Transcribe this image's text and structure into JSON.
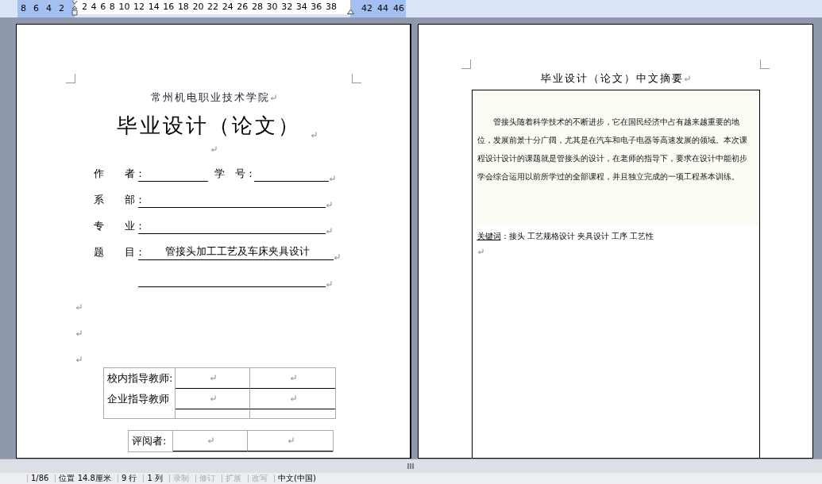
{
  "ruler": {
    "left_numbers": [
      "8",
      "6",
      "4",
      "2"
    ],
    "numbers": [
      "2",
      "4",
      "6",
      "8",
      "10",
      "12",
      "14",
      "16",
      "18",
      "20",
      "22",
      "24",
      "26",
      "28",
      "30",
      "32",
      "34",
      "36",
      "38"
    ],
    "right_numbers": [
      "42",
      "44",
      "46"
    ]
  },
  "cover_page": {
    "school": "常州机电职业技术学院",
    "title": "毕业设计（论文）",
    "fields": [
      {
        "kind": "pair",
        "label": "作　　者：",
        "label_2": "学　号："
      },
      {
        "kind": "line",
        "label": "系　　部："
      },
      {
        "kind": "line",
        "label": "专　　业："
      },
      {
        "kind": "value",
        "label": "题　　目：",
        "value": "管接头加工工艺及车床夹具设计"
      },
      {
        "kind": "blank"
      }
    ],
    "advisor_table": {
      "rows": [
        {
          "kind": "label",
          "label": "校内指导教师:"
        },
        {
          "kind": "label",
          "label": "企业指导教师"
        },
        {
          "kind": "empty"
        }
      ]
    },
    "reviewer_table": {
      "rows": [
        {
          "kind": "label",
          "label": "评阅者:"
        }
      ]
    }
  },
  "abstract_page": {
    "heading": "毕业设计（论文）中文摘要",
    "paragraph": "管接头随着科学技术的不断进步，它在国民经济中占有越来越重要的地位，发展前景十分广阔，尤其是在汽车和电子电器等高速发展的领域。本次课程设计设计的课题就是管接头的设计，在老师的指导下，要求在设计中能初步学会综合运用以前所学过的全部课程，并且独立完成的一项工程基本训练。",
    "keywords_label": "关键词",
    "keywords": "：接头 工艺规格设计 夹具设计 工序 工艺性"
  },
  "status_bar": [
    {
      "text": "1/86",
      "disabled": false
    },
    {
      "text": "位置 14.8厘米",
      "disabled": false
    },
    {
      "text": "9 行",
      "disabled": false
    },
    {
      "text": "1 列",
      "disabled": false
    },
    {
      "text": "录制",
      "disabled": true
    },
    {
      "text": "修订",
      "disabled": true
    },
    {
      "text": "扩展",
      "disabled": true
    },
    {
      "text": "改写",
      "disabled": true
    },
    {
      "text": "中文(中国)",
      "disabled": false
    }
  ]
}
